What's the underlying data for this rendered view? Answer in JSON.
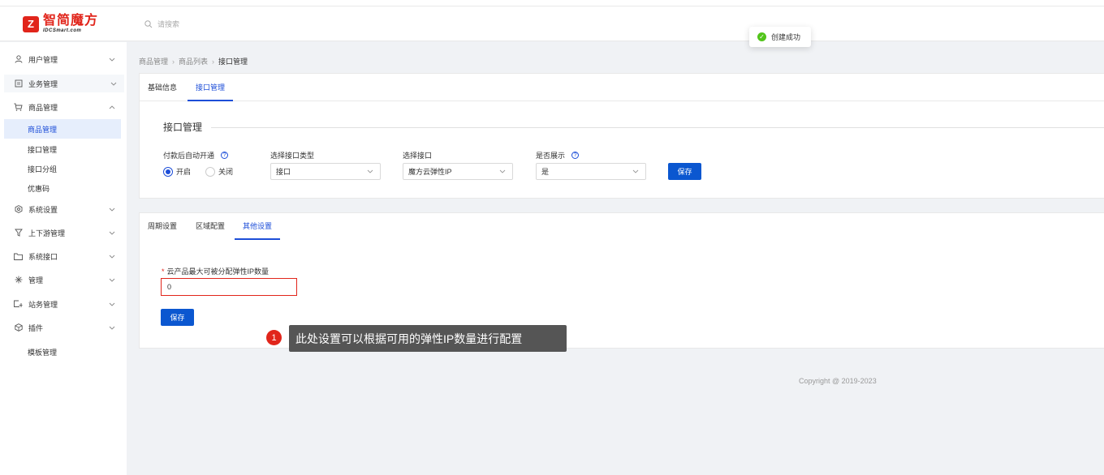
{
  "header": {
    "logo_cn": "智简魔方",
    "logo_en": "IDCSmart.com",
    "search_placeholder": "请搜索"
  },
  "toast": {
    "text": "创建成功"
  },
  "sidebar": {
    "items": [
      {
        "label": "用户管理",
        "icon": "user-icon"
      },
      {
        "label": "业务管理",
        "icon": "list-icon"
      },
      {
        "label": "商品管理",
        "icon": "cart-icon"
      },
      {
        "label": "系统设置",
        "icon": "settings-icon"
      },
      {
        "label": "上下游管理",
        "icon": "filter-icon"
      },
      {
        "label": "系统接口",
        "icon": "folder-icon"
      },
      {
        "label": "管理",
        "icon": "sparkle-icon"
      },
      {
        "label": "站务管理",
        "icon": "site-icon"
      },
      {
        "label": "插件",
        "icon": "cube-icon"
      }
    ],
    "sub_items": [
      "商品管理",
      "接口管理",
      "接口分组",
      "优惠码"
    ],
    "extra_item": "模板管理"
  },
  "breadcrumb": [
    "商品管理",
    "商品列表",
    "接口管理"
  ],
  "tabs": [
    "基础信息",
    "接口管理"
  ],
  "section": {
    "title": "接口管理",
    "fields": {
      "auto_open_label": "付款后自动开通",
      "radio_on": "开启",
      "radio_off": "关闭",
      "type_label": "选择接口类型",
      "type_value": "接口",
      "iface_label": "选择接口",
      "iface_value": "魔方云弹性IP",
      "show_label": "是否展示",
      "show_value": "是",
      "save_label": "保存"
    }
  },
  "sub_tabs": [
    "周期设置",
    "区域配置",
    "其他设置"
  ],
  "other": {
    "field_label": "云产品最大可被分配弹性IP数量",
    "field_value": "0",
    "save_label": "保存"
  },
  "tip": {
    "number": "1",
    "text": "此处设置可以根据可用的弹性IP数量进行配置"
  },
  "copyright": "Copyright @ 2019-2023"
}
